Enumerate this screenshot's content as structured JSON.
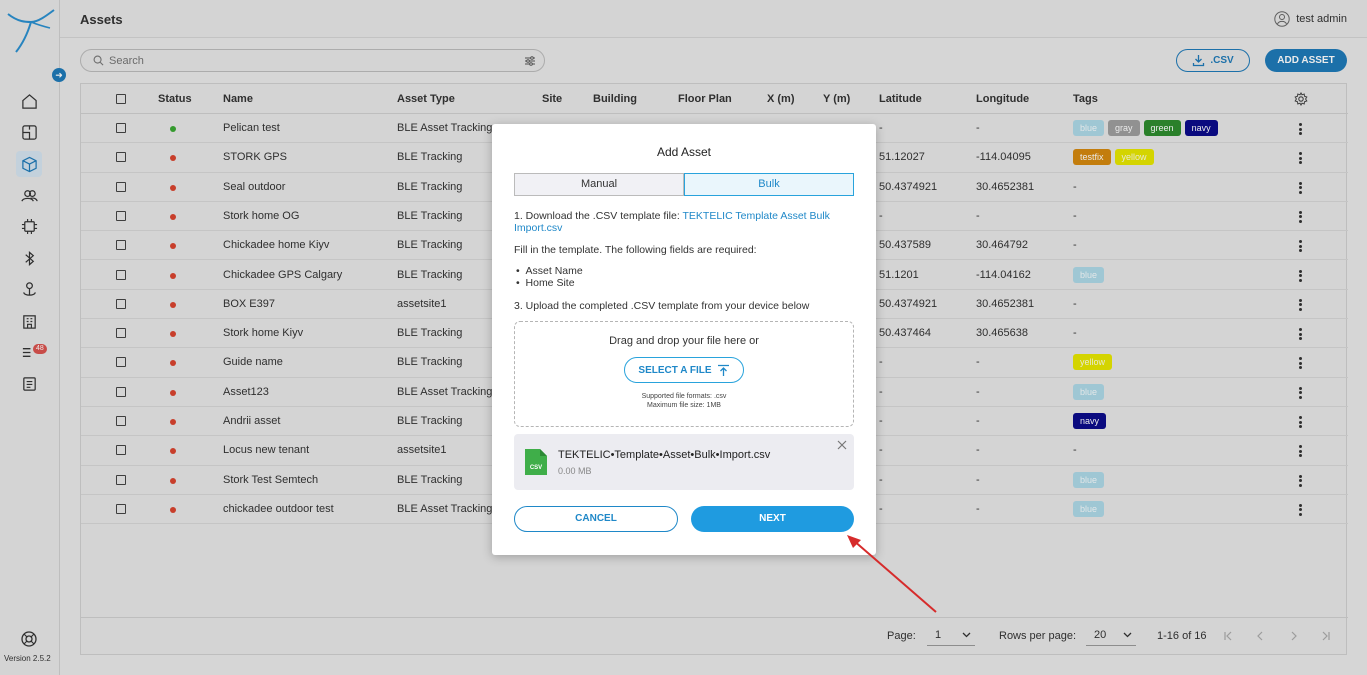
{
  "app": {
    "page_title": "Assets",
    "user_name": "test admin",
    "version": "Version 2.5.2",
    "notification_count": "48"
  },
  "sidebar": {
    "items": [
      {
        "icon": "home-icon"
      },
      {
        "icon": "floorplan-icon"
      },
      {
        "icon": "cube-icon",
        "active": true
      },
      {
        "icon": "users-icon"
      },
      {
        "icon": "chip-icon"
      },
      {
        "icon": "bluetooth-icon"
      },
      {
        "icon": "anchor-icon"
      },
      {
        "icon": "building-icon"
      },
      {
        "icon": "alerts-icon"
      },
      {
        "icon": "reports-icon"
      }
    ]
  },
  "toolbar": {
    "search_placeholder": "Search",
    "csv_label": ".CSV",
    "add_label": "ADD ASSET"
  },
  "table": {
    "headers": [
      "Status",
      "Name",
      "Asset Type",
      "Site",
      "Building",
      "Floor Plan",
      "X (m)",
      "Y (m)",
      "Latitude",
      "Longitude",
      "Tags"
    ],
    "rows": [
      {
        "status": "green",
        "name": "Pelican test",
        "type": "BLE Asset Tracking",
        "lat": "-",
        "lon": "-",
        "tags": [
          {
            "t": "blue",
            "c": "#add8e6"
          },
          {
            "t": "gray",
            "c": "#9e9e9e"
          },
          {
            "t": "green",
            "c": "#2e8b2e"
          },
          {
            "t": "navy",
            "c": "#0b0b8a"
          }
        ]
      },
      {
        "status": "red",
        "name": "STORK GPS",
        "type": "BLE Tracking",
        "lat": "51.12027",
        "lon": "-114.04095",
        "tags": [
          {
            "t": "testfix",
            "c": "#d4880f"
          },
          {
            "t": "yellow",
            "c": "#e6e600"
          }
        ]
      },
      {
        "status": "red",
        "name": "Seal outdoor",
        "type": "BLE Tracking",
        "lat": "50.4374921",
        "lon": "30.4652381",
        "tags": [],
        "tag_text": "-"
      },
      {
        "status": "red",
        "name": "Stork home OG",
        "type": "BLE Tracking",
        "lat": "-",
        "lon": "-",
        "tags": [],
        "tag_text": "-"
      },
      {
        "status": "red",
        "name": "Chickadee home Kiyv",
        "type": "BLE Tracking",
        "lat": "50.437589",
        "lon": "30.464792",
        "tags": [],
        "tag_text": "-"
      },
      {
        "status": "red",
        "name": "Chickadee GPS Calgary",
        "type": "BLE Tracking",
        "lat": "51.1201",
        "lon": "-114.04162",
        "tags": [
          {
            "t": "blue",
            "c": "#add8e6"
          }
        ]
      },
      {
        "status": "red",
        "name": "BOX E397",
        "type": "assetsite1",
        "lat": "50.4374921",
        "lon": "30.4652381",
        "tags": [],
        "tag_text": "-"
      },
      {
        "status": "red",
        "name": "Stork home Kiyv",
        "type": "BLE Tracking",
        "lat": "50.437464",
        "lon": "30.465638",
        "tags": [],
        "tag_text": "-"
      },
      {
        "status": "red",
        "name": "Guide name",
        "type": "BLE Tracking",
        "lat": "-",
        "lon": "-",
        "tags": [
          {
            "t": "yellow",
            "c": "#e6e600"
          }
        ]
      },
      {
        "status": "red",
        "name": "Asset123",
        "type": "BLE Asset Tracking",
        "lat": "-",
        "lon": "-",
        "tags": [
          {
            "t": "blue",
            "c": "#add8e6"
          }
        ]
      },
      {
        "status": "red",
        "name": "Andrii asset",
        "type": "BLE Tracking",
        "lat": "-",
        "lon": "-",
        "tags": [
          {
            "t": "navy",
            "c": "#0b0b8a"
          }
        ]
      },
      {
        "status": "red",
        "name": "Locus new tenant",
        "type": "assetsite1",
        "lat": "-",
        "lon": "-",
        "tags": [],
        "tag_text": "-"
      },
      {
        "status": "red",
        "name": "Stork Test Semtech",
        "type": "BLE Tracking",
        "lat": "-",
        "lon": "-",
        "tags": [
          {
            "t": "blue",
            "c": "#add8e6"
          }
        ]
      },
      {
        "status": "red",
        "name": "chickadee outdoor test",
        "type": "BLE Asset Tracking",
        "lat": "-",
        "lon": "-",
        "tags": [
          {
            "t": "blue",
            "c": "#add8e6"
          }
        ]
      }
    ]
  },
  "pagination": {
    "page_label": "Page:",
    "page_value": "1",
    "rows_label": "Rows per page:",
    "rows_value": "20",
    "range": "1-16 of 16"
  },
  "modal": {
    "title": "Add Asset",
    "tab_manual": "Manual",
    "tab_bulk": "Bulk",
    "step1_prefix": "1. Download the .CSV template file: ",
    "step1_link": "TEKTELIC Template Asset Bulk Import.csv",
    "step2": "Fill in the template. The following fields are required:",
    "required_fields": [
      "Asset Name",
      "Home Site"
    ],
    "step3": "3. Upload the completed .CSV template from your device below",
    "dropzone_text": "Drag and drop your file here or",
    "select_file_label": "SELECT A FILE",
    "supported_formats": "Supported file formats: .csv",
    "max_size": "Maximum file size: 1MB",
    "file_name": "TEKTELIC•Template•Asset•Bulk•Import.csv",
    "file_size": "0.00 MB",
    "file_icon_label": "CSV",
    "cancel_label": "CANCEL",
    "next_label": "NEXT"
  },
  "colors": {
    "accent": "#1f7ab8",
    "accent_light": "#1f9be0",
    "status_green": "#3aa832",
    "status_red": "#d9442f",
    "annotation_arrow": "#d62b2b"
  }
}
